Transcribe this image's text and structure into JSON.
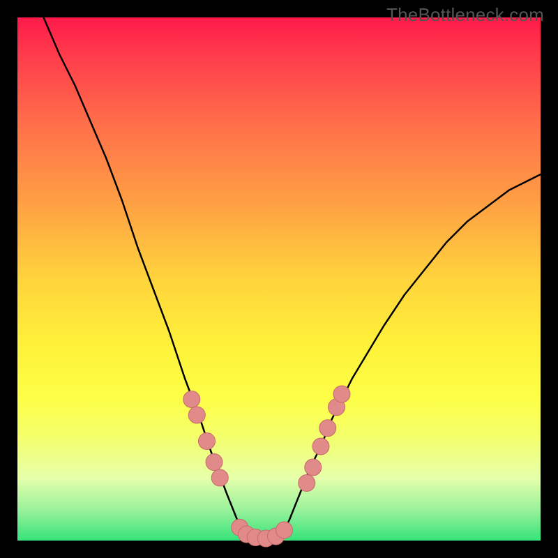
{
  "watermark": "TheBottleneck.com",
  "colors": {
    "curve": "#000000",
    "marker_fill": "#e08a8a",
    "marker_stroke": "#c86a6a",
    "frame": "#000000"
  },
  "chart_data": {
    "type": "line",
    "title": "",
    "xlabel": "",
    "ylabel": "",
    "xlim": [
      0,
      100
    ],
    "ylim": [
      0,
      100
    ],
    "grid": false,
    "series": [
      {
        "name": "left_curve",
        "x": [
          5,
          8,
          11,
          14,
          17,
          20,
          23,
          26,
          29,
          32,
          33.5,
          35,
          36,
          37,
          38.5,
          40,
          42,
          44
        ],
        "y": [
          100,
          93,
          87,
          80,
          73,
          65,
          56,
          48,
          40,
          31,
          27,
          23,
          20,
          17,
          13,
          9,
          4,
          0
        ]
      },
      {
        "name": "right_curve",
        "x": [
          50,
          52,
          54,
          56,
          58,
          60,
          62,
          64,
          67,
          70,
          74,
          78,
          82,
          86,
          90,
          94,
          98,
          100
        ],
        "y": [
          0,
          4,
          9,
          14,
          18,
          23,
          27,
          31,
          36,
          41,
          47,
          52,
          57,
          61,
          64,
          67,
          69,
          70
        ]
      },
      {
        "name": "flat_bottom",
        "x": [
          44,
          45,
          46,
          47,
          48,
          49,
          50
        ],
        "y": [
          0,
          0,
          0,
          0,
          0,
          0,
          0
        ]
      }
    ],
    "markers": [
      {
        "x": 33.3,
        "y": 27
      },
      {
        "x": 34.3,
        "y": 24
      },
      {
        "x": 36.2,
        "y": 19
      },
      {
        "x": 37.6,
        "y": 15
      },
      {
        "x": 38.7,
        "y": 12
      },
      {
        "x": 42.5,
        "y": 2.5
      },
      {
        "x": 43.8,
        "y": 1.2
      },
      {
        "x": 45.5,
        "y": 0.6
      },
      {
        "x": 47.5,
        "y": 0.4
      },
      {
        "x": 49.4,
        "y": 0.8
      },
      {
        "x": 51.0,
        "y": 2.0
      },
      {
        "x": 55.3,
        "y": 11
      },
      {
        "x": 56.5,
        "y": 14
      },
      {
        "x": 58.0,
        "y": 18
      },
      {
        "x": 59.3,
        "y": 21.5
      },
      {
        "x": 61.0,
        "y": 25.5
      },
      {
        "x": 62.0,
        "y": 28
      }
    ],
    "marker_radius": 1.6
  }
}
